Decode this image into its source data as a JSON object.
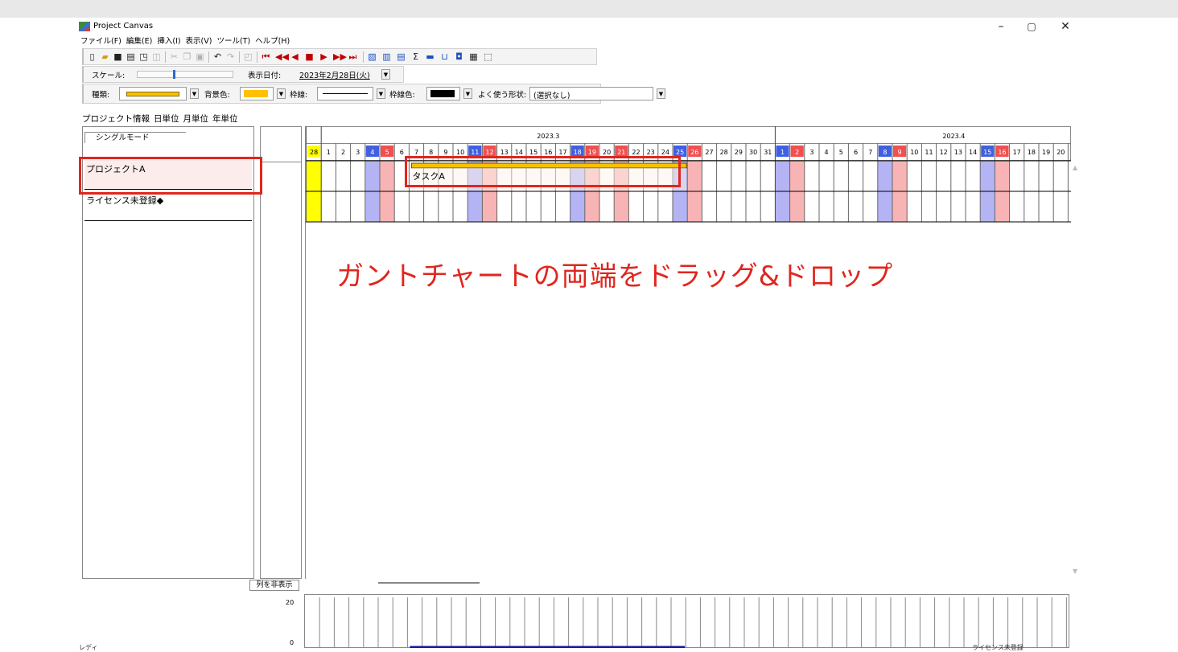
{
  "window": {
    "title": "Project Canvas"
  },
  "menubar": [
    "ファイル(F)",
    "編集(E)",
    "挿入(I)",
    "表示(V)",
    "ツール(T)",
    "ヘルプ(H)"
  ],
  "toolbar2": {
    "scale_label": "スケール:",
    "date_label": "表示日付:",
    "date_value": "2023年2月28日(火)"
  },
  "toolbar3": {
    "type_label": "種類:",
    "bg_label": "背景色:",
    "border_label": "枠線:",
    "border_color_label": "枠線色:",
    "shape_label": "よく使う形状:",
    "shape_value": "(選択なし)"
  },
  "colors": {
    "bar_fill": "#f6c200",
    "bg_swatch": "#ffc000",
    "border_swatch": "#000000",
    "weekend_sat": "#b4b4f4",
    "weekend_sun": "#f8b4b4",
    "today": "#ffff00",
    "annotation": "#e0261e"
  },
  "tabs": [
    "プロジェクト情報",
    "日単位",
    "月単位",
    "年単位"
  ],
  "left_panel": {
    "mode_button": "シングルモード",
    "projects": [
      "プロジェクトA",
      "ライセンス未登録◆"
    ],
    "hide_columns_button": "列を非表示"
  },
  "timeline": {
    "months": [
      "2023.3",
      "2023.4"
    ],
    "days": [
      {
        "d": "28",
        "k": "today"
      },
      {
        "d": "1",
        "k": ""
      },
      {
        "d": "2",
        "k": ""
      },
      {
        "d": "3",
        "k": ""
      },
      {
        "d": "4",
        "k": "sat"
      },
      {
        "d": "5",
        "k": "sun"
      },
      {
        "d": "6",
        "k": ""
      },
      {
        "d": "7",
        "k": ""
      },
      {
        "d": "8",
        "k": ""
      },
      {
        "d": "9",
        "k": ""
      },
      {
        "d": "10",
        "k": ""
      },
      {
        "d": "11",
        "k": "sat"
      },
      {
        "d": "12",
        "k": "sun"
      },
      {
        "d": "13",
        "k": ""
      },
      {
        "d": "14",
        "k": ""
      },
      {
        "d": "15",
        "k": ""
      },
      {
        "d": "16",
        "k": ""
      },
      {
        "d": "17",
        "k": ""
      },
      {
        "d": "18",
        "k": "sat"
      },
      {
        "d": "19",
        "k": "sun"
      },
      {
        "d": "20",
        "k": ""
      },
      {
        "d": "21",
        "k": "sun"
      },
      {
        "d": "22",
        "k": ""
      },
      {
        "d": "23",
        "k": ""
      },
      {
        "d": "24",
        "k": ""
      },
      {
        "d": "25",
        "k": "sat"
      },
      {
        "d": "26",
        "k": "sun"
      },
      {
        "d": "27",
        "k": ""
      },
      {
        "d": "28",
        "k": ""
      },
      {
        "d": "29",
        "k": ""
      },
      {
        "d": "30",
        "k": ""
      },
      {
        "d": "31",
        "k": ""
      },
      {
        "d": "1",
        "k": "sat"
      },
      {
        "d": "2",
        "k": "sun"
      },
      {
        "d": "3",
        "k": ""
      },
      {
        "d": "4",
        "k": ""
      },
      {
        "d": "5",
        "k": ""
      },
      {
        "d": "6",
        "k": ""
      },
      {
        "d": "7",
        "k": ""
      },
      {
        "d": "8",
        "k": "sat"
      },
      {
        "d": "9",
        "k": "sun"
      },
      {
        "d": "10",
        "k": ""
      },
      {
        "d": "11",
        "k": ""
      },
      {
        "d": "12",
        "k": ""
      },
      {
        "d": "13",
        "k": ""
      },
      {
        "d": "14",
        "k": ""
      },
      {
        "d": "15",
        "k": "sat"
      },
      {
        "d": "16",
        "k": "sun"
      },
      {
        "d": "17",
        "k": ""
      },
      {
        "d": "18",
        "k": ""
      },
      {
        "d": "19",
        "k": ""
      },
      {
        "d": "20",
        "k": ""
      }
    ]
  },
  "task": {
    "label": "タスクA",
    "start_day_index": 7,
    "end_day_index": 25
  },
  "annotation": "ガントチャートの両端をドラッグ&ドロップ",
  "graph": {
    "y_ticks": [
      "20",
      "0"
    ]
  },
  "status": {
    "left": "レディ",
    "right": "ライセンス未登録"
  }
}
